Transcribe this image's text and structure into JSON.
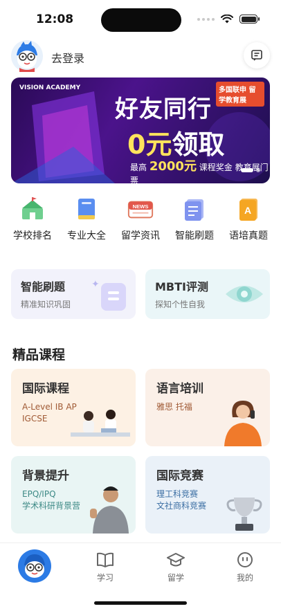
{
  "status": {
    "time": "12:08"
  },
  "header": {
    "login_label": "去登录"
  },
  "banner": {
    "brand": "VISION ACADEMY",
    "headline": "好友同行",
    "offer_zero": "0元",
    "offer_suffix": "领取",
    "corner_text": "多国联申 留学教育展",
    "amount_prefix": "最高",
    "amount": "2000元",
    "amount_suffix": "课程奖金 教育展门票"
  },
  "quick_links": [
    {
      "label": "学校排名",
      "icon": "school-icon"
    },
    {
      "label": "专业大全",
      "icon": "book-icon"
    },
    {
      "label": "留学资讯",
      "icon": "news-icon"
    },
    {
      "label": "智能刷题",
      "icon": "notes-icon"
    },
    {
      "label": "语培真题",
      "icon": "language-book-icon"
    }
  ],
  "features": [
    {
      "title": "智能刷题",
      "subtitle": "精准知识巩固"
    },
    {
      "title": "MBTI评测",
      "subtitle": "探知个性自我"
    }
  ],
  "section": {
    "title": "精品课程"
  },
  "courses": [
    {
      "title": "国际课程",
      "line1": "A-Level IB AP",
      "line2": "IGCSE"
    },
    {
      "title": "语言培训",
      "line1": "雅思 托福",
      "line2": ""
    },
    {
      "title": "背景提升",
      "line1": "EPQ/IPQ",
      "line2": "学术科研背景营"
    },
    {
      "title": "国际竞赛",
      "line1": "理工科竞赛",
      "line2": "文社商科竞赛"
    }
  ],
  "tabbar": {
    "items": [
      {
        "label": "",
        "icon": "mascot-home-icon"
      },
      {
        "label": "学习",
        "icon": "book-open-icon"
      },
      {
        "label": "留学",
        "icon": "graduation-cap-icon"
      },
      {
        "label": "我的",
        "icon": "smile-icon"
      }
    ]
  },
  "colors": {
    "accent_purple": "#4b138b",
    "highlight_yellow": "#ffe35c",
    "course_orange": "#fdf1e4",
    "course_mint": "#e9f5f4",
    "course_blue": "#eaf1f8"
  }
}
